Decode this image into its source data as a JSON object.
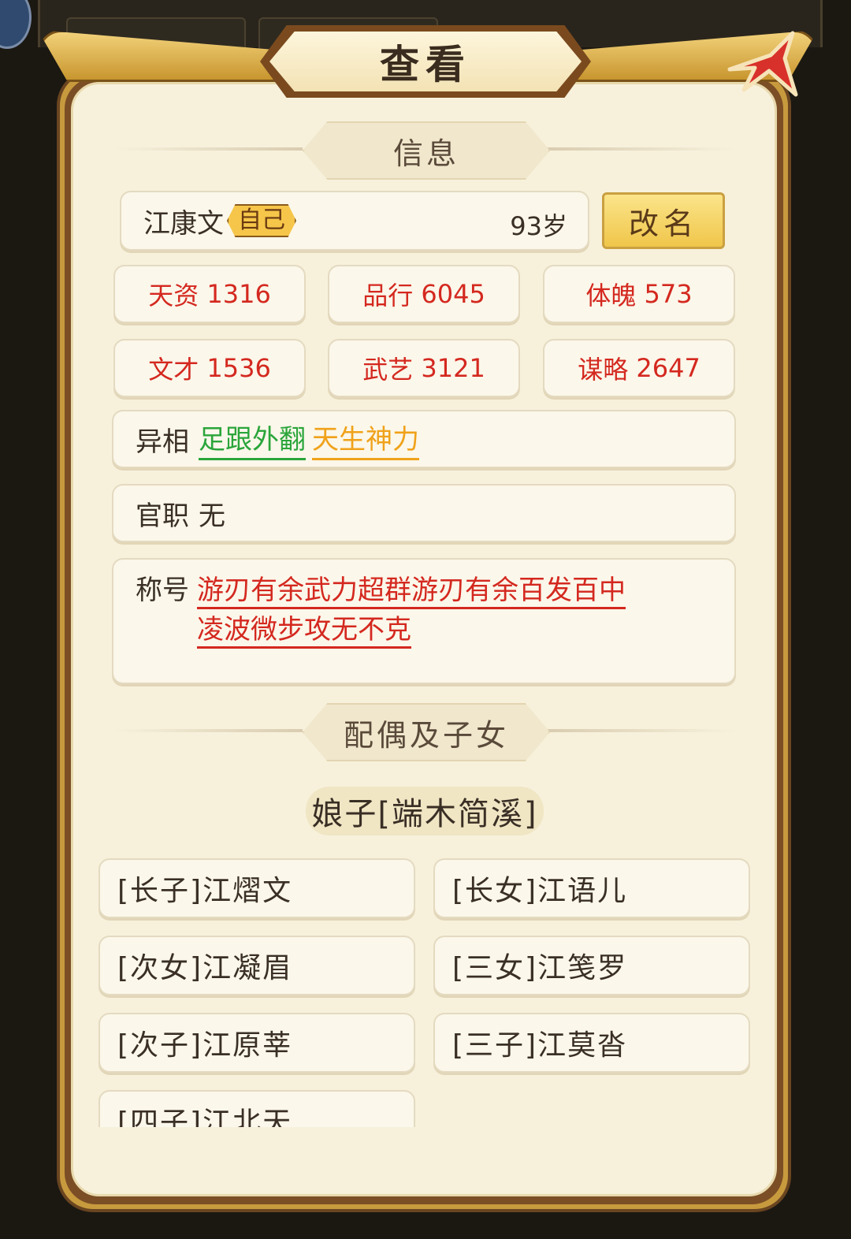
{
  "window": {
    "title": "查看"
  },
  "sections": {
    "info": "信息",
    "family": "配偶及子女"
  },
  "profile": {
    "name": "江康文",
    "self_tag": "自己",
    "age": "93岁",
    "rename_label": "改名"
  },
  "stats": [
    {
      "label": "天资",
      "value": "1316"
    },
    {
      "label": "品行",
      "value": "6045"
    },
    {
      "label": "体魄",
      "value": "573"
    },
    {
      "label": "文才",
      "value": "1536"
    },
    {
      "label": "武艺",
      "value": "3121"
    },
    {
      "label": "谋略",
      "value": "2647"
    }
  ],
  "traits": {
    "label": "异相",
    "items": [
      {
        "text": "足跟外翻",
        "color": "#2aa53a"
      },
      {
        "text": "天生神力",
        "color": "#f0a21a"
      }
    ]
  },
  "office": {
    "label": "官职",
    "value": "无"
  },
  "titles": {
    "label": "称号",
    "line1": "游刃有余武力超群游刃有余百发百中",
    "line2": "凌波微步攻无不克"
  },
  "spouse": "娘子[端木简溪]",
  "children": [
    "[长子]江熠文",
    "[长女]江语儿",
    "[次女]江凝眉",
    "[三女]江笺罗",
    "[次子]江原莘",
    "[三子]江莫沓",
    "[四子]江北天"
  ],
  "colors": {
    "stat_red": "#d4281f",
    "panel_gold": "#c79a3e",
    "close_red": "#d8302a"
  }
}
